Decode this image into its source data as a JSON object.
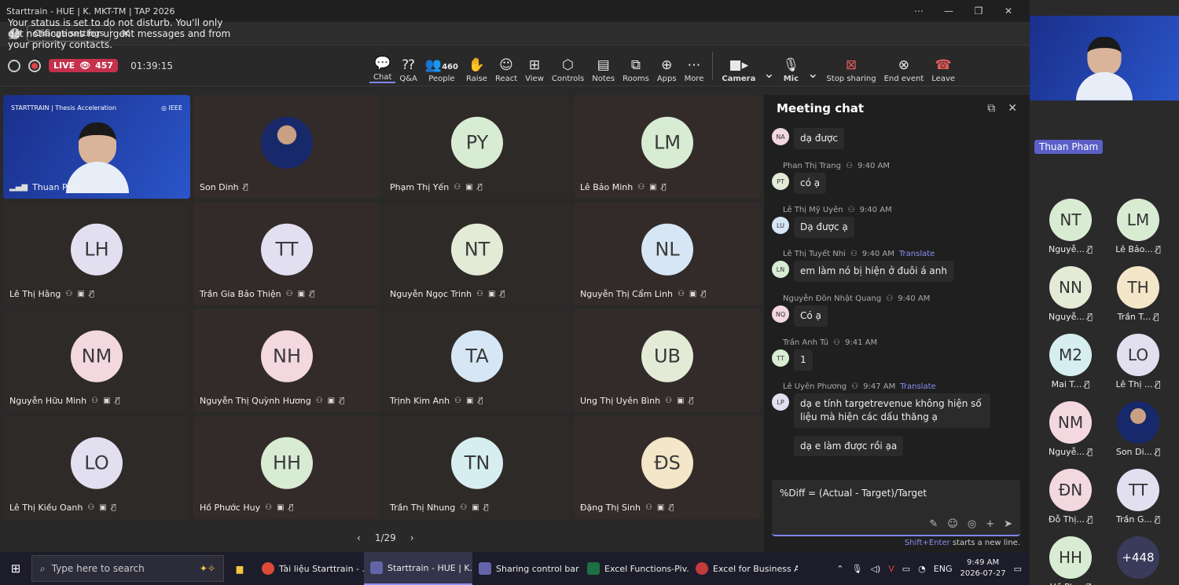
{
  "window": {
    "title": "Starttrain - HUE | K. MKT-TM | TAP 2026"
  },
  "notice": {
    "message": "Your status is set to do not disturb. You'll only get notifications for urgent messages and from your priority contacts.",
    "button": "Change settings"
  },
  "toolbar": {
    "live_label": "LIVE",
    "viewers": "457",
    "timer": "01:39:15",
    "people_count": "460",
    "items": [
      "Chat",
      "Q&A",
      "People",
      "Raise",
      "React",
      "View",
      "Controls",
      "Notes",
      "Rooms",
      "Apps",
      "More"
    ],
    "camera": "Camera",
    "mic": "Mic",
    "stop_sharing": "Stop sharing",
    "end_event": "End event",
    "leave": "Leave"
  },
  "tiles": [
    {
      "name": "Thuan Pham",
      "initials": "",
      "color": ""
    },
    {
      "name": "Son Dinh",
      "initials": "",
      "color": ""
    },
    {
      "name": "Phạm Thị Yến",
      "initials": "PY",
      "color": "#d8ecd4"
    },
    {
      "name": "Lê Bảo Minh",
      "initials": "LM",
      "color": "#d8ecd4"
    },
    {
      "name": "Lê Thị Hằng",
      "initials": "LH",
      "color": "#e2dff0"
    },
    {
      "name": "Trần Gia Bảo Thiện",
      "initials": "TT",
      "color": "#e2dff0"
    },
    {
      "name": "Nguyễn Ngọc Trinh",
      "initials": "NT",
      "color": "#e3ead6"
    },
    {
      "name": "Nguyễn Thị Cẩm Linh",
      "initials": "NL",
      "color": "#d6e6f4"
    },
    {
      "name": "Nguyễn Hữu Minh",
      "initials": "NM",
      "color": "#f3d8e0"
    },
    {
      "name": "Nguyễn Thị Quỳnh Hương",
      "initials": "NH",
      "color": "#f3d8e0"
    },
    {
      "name": "Trịnh Kim Anh",
      "initials": "TA",
      "color": "#d6e6f4"
    },
    {
      "name": "Ung Thị Uyên Bình",
      "initials": "UB",
      "color": "#e3ead6"
    },
    {
      "name": "Lê Thị Kiều Oanh",
      "initials": "LO",
      "color": "#e2dff0"
    },
    {
      "name": "Hồ Phước Huy",
      "initials": "HH",
      "color": "#d8ecd4"
    },
    {
      "name": "Trần Thị Nhung",
      "initials": "TN",
      "color": "#d6eef0"
    },
    {
      "name": "Đặng Thị Sinh",
      "initials": "ĐS",
      "color": "#f4e6c8"
    }
  ],
  "pager": {
    "label": "1/29"
  },
  "chat": {
    "title": "Meeting chat",
    "messages": [
      {
        "author": "",
        "time": "",
        "translate": "",
        "initials": "NA",
        "color": "#f3d8e0",
        "text": "dạ được"
      },
      {
        "author": "Phan Thị Trang",
        "time": "9:40 AM",
        "translate": "",
        "initials": "PT",
        "color": "#e3ead6",
        "text": "có ạ"
      },
      {
        "author": "Lê Thị Mỹ Uyên",
        "time": "9:40 AM",
        "translate": "",
        "initials": "LU",
        "color": "#d6e6f4",
        "text": "Dạ được ạ"
      },
      {
        "author": "Lê Thị Tuyết Nhi",
        "time": "9:40 AM",
        "translate": "Translate",
        "initials": "LN",
        "color": "#d8ecd4",
        "text": "em làm nó bị hiện ở đuôi á anh"
      },
      {
        "author": "Nguyễn Đôn Nhật Quang",
        "time": "9:40 AM",
        "translate": "",
        "initials": "NQ",
        "color": "#f3d8e0",
        "text": "Có ạ"
      },
      {
        "author": "Trần Anh Tú",
        "time": "9:41 AM",
        "translate": "",
        "initials": "TT",
        "color": "#d8ecd4",
        "text": "1"
      },
      {
        "author": "Lê Uyên Phương",
        "time": "9:47 AM",
        "translate": "Translate",
        "initials": "LP",
        "color": "#e2dff0",
        "text": "dạ e tính targetrevenue không hiện số liệu mà hiện các dấu thăng ạ"
      },
      {
        "author": "",
        "time": "",
        "translate": "",
        "initials": "",
        "color": "",
        "text": "dạ e làm được rồi ạa"
      }
    ],
    "compose_text": "%Diff = (Actual - Target)/Target",
    "hint_key": "Shift+Enter",
    "hint_rest": " starts a new line."
  },
  "strip": {
    "self_name": "Thuan Pham",
    "people": [
      {
        "initials": "NT",
        "label": "Nguyễ...",
        "color": "#d8ecd4"
      },
      {
        "initials": "LM",
        "label": "Lê Bảo...",
        "color": "#d8ecd4"
      },
      {
        "initials": "NN",
        "label": "Nguyễ...",
        "color": "#e3ead6"
      },
      {
        "initials": "TH",
        "label": "Trần T...",
        "color": "#f4e6c8"
      },
      {
        "initials": "M2",
        "label": "Mai T...",
        "color": "#d6eef0"
      },
      {
        "initials": "LO",
        "label": "Lê Thị ...",
        "color": "#e2dff0"
      },
      {
        "initials": "NM",
        "label": "Nguyễ...",
        "color": "#f3d8e0"
      },
      {
        "initials": "",
        "label": "Son Di...",
        "color": ""
      },
      {
        "initials": "ĐN",
        "label": "Đỗ Thị...",
        "color": "#f3d8e0"
      },
      {
        "initials": "TT",
        "label": "Trần G...",
        "color": "#e2dff0"
      },
      {
        "initials": "HH",
        "label": "Hồ Ph...",
        "color": "#d8ecd4"
      },
      {
        "initials": "+448",
        "label": "",
        "color": ""
      }
    ]
  },
  "taskbar": {
    "search_placeholder": "Type here to search",
    "tasks": [
      "Tài liệu Starttrain - ...",
      "Starttrain - HUE | K...",
      "Sharing control bar ...",
      "Excel Functions-Piv...",
      "Excel for Business A..."
    ],
    "lang": "ENG",
    "time": "9:49 AM",
    "date": "2026-07-27"
  }
}
